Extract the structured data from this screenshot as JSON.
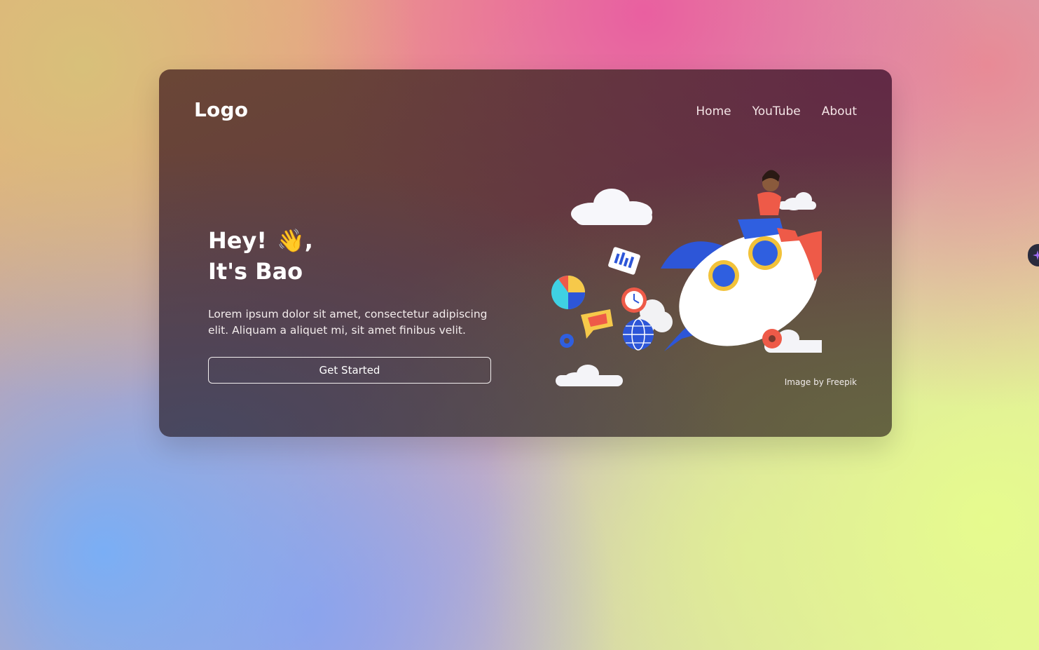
{
  "header": {
    "logo": "Logo",
    "nav": [
      {
        "label": "Home"
      },
      {
        "label": "YouTube"
      },
      {
        "label": "About"
      }
    ]
  },
  "hero": {
    "heading_line1": "Hey!",
    "wave_emoji": "👋",
    "heading_comma": ",",
    "heading_line2": "It's Bao",
    "description": "Lorem ipsum dolor sit amet, consectetur adipiscing elit. Aliquam a aliquet mi, sit amet finibus velit.",
    "cta_label": "Get Started"
  },
  "illustration": {
    "icon": "rocket-girl-illustration",
    "credit": "Image by Freepik"
  },
  "side_toggle": {
    "icon": "sparkle-icon"
  },
  "colors": {
    "accent_blue": "#2f5fe0",
    "accent_red": "#ee5a48",
    "text_white": "#ffffff"
  }
}
